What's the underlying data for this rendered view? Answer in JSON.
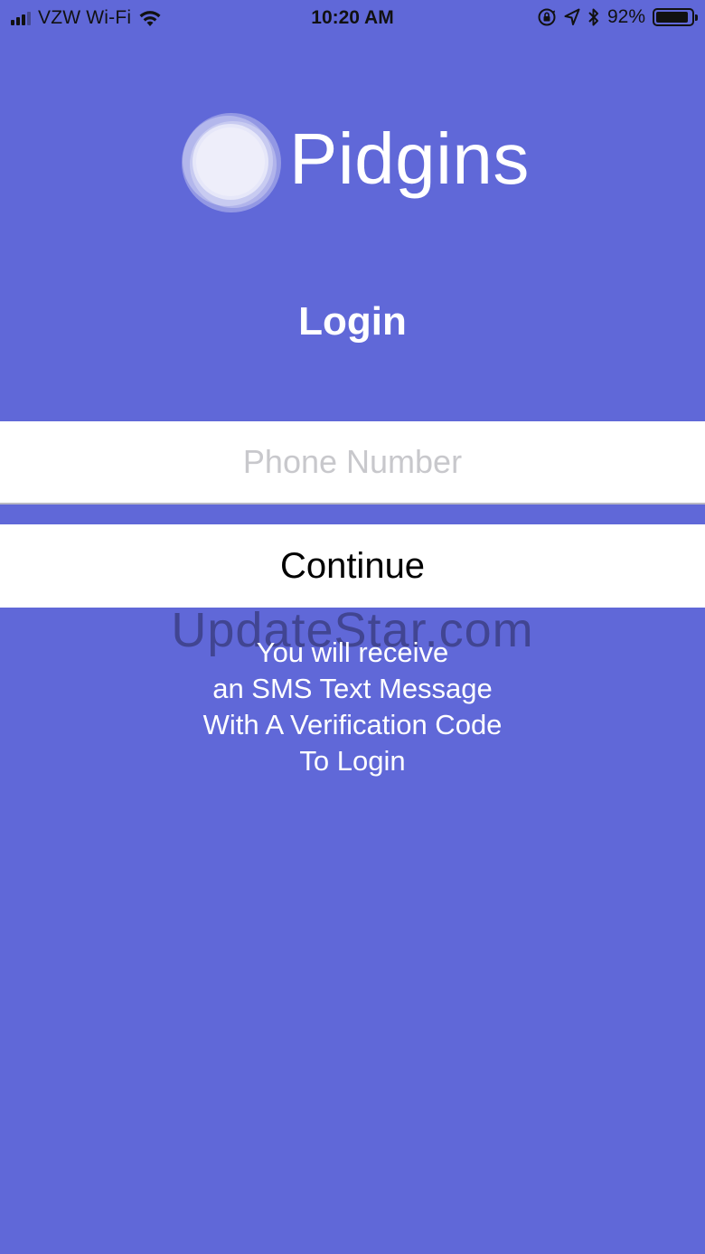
{
  "status_bar": {
    "carrier": "VZW Wi-Fi",
    "time": "10:20 AM",
    "battery_percent": "92%",
    "battery_level": 0.92,
    "icons": [
      "signal-icon",
      "wifi-icon",
      "orientation-lock-icon",
      "location-arrow-icon",
      "bluetooth-icon",
      "battery-icon"
    ]
  },
  "app": {
    "name": "Pidgins",
    "logo_icon": "circle-logo-icon"
  },
  "login": {
    "title": "Login",
    "phone_placeholder": "Phone Number",
    "phone_value": "",
    "continue_label": "Continue",
    "info_lines": [
      "You will receive",
      "an SMS Text Message",
      "With A Verification Code",
      "To Login"
    ]
  },
  "watermark": "UpdateStar.com",
  "colors": {
    "background": "#6068d8",
    "field_background": "#ffffff",
    "placeholder": "#c8c8cc",
    "text": "#ffffff"
  }
}
